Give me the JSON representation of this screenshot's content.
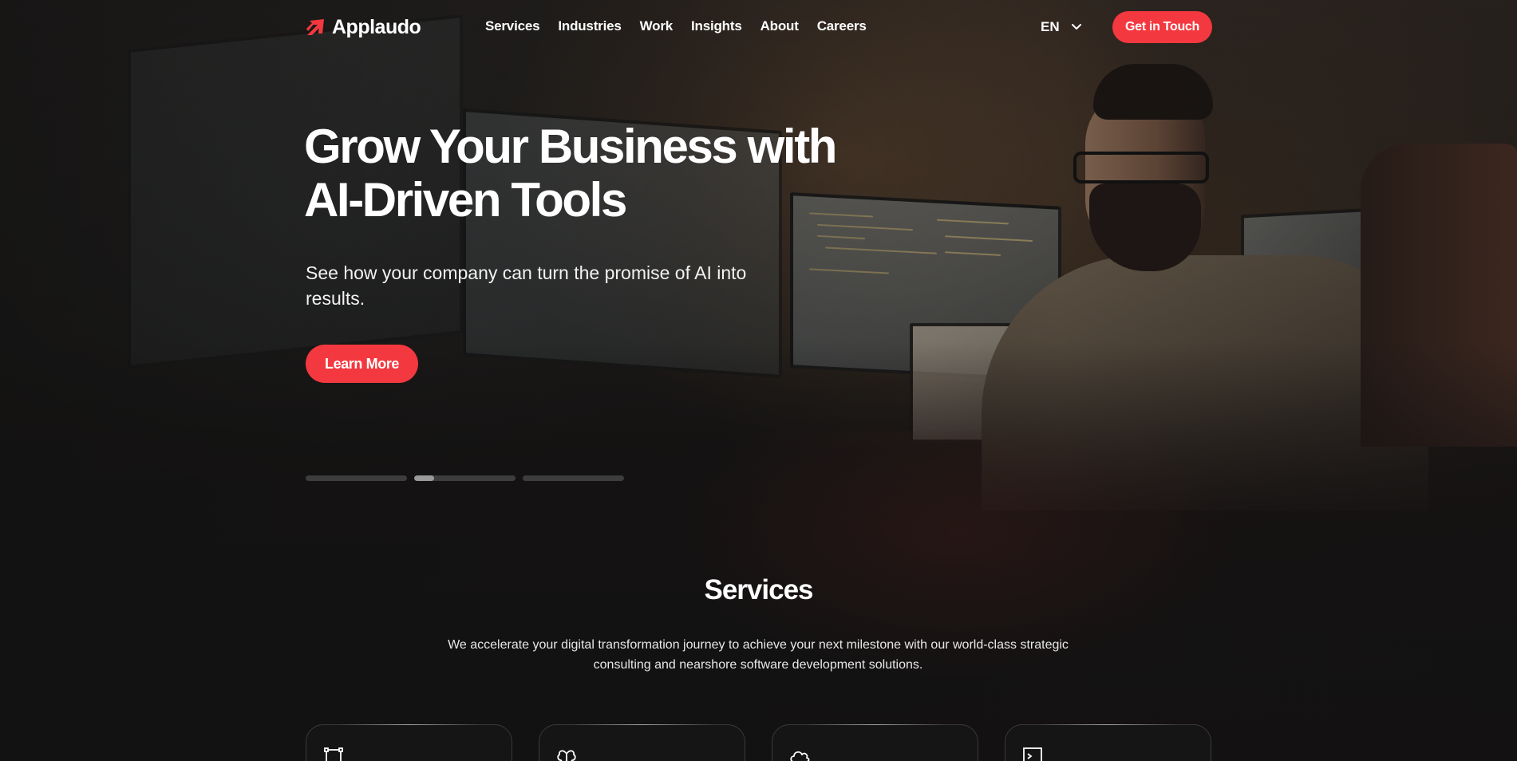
{
  "brand": {
    "name": "Applaudo",
    "accent": "#f4383f"
  },
  "nav": {
    "links": [
      "Services",
      "Industries",
      "Work",
      "Insights",
      "About",
      "Careers"
    ],
    "language": "EN",
    "cta": "Get in Touch"
  },
  "hero": {
    "title_line1": "Grow Your Business with",
    "title_line2": "AI-Driven Tools",
    "subtitle": "See how your company can turn the promise of AI into results.",
    "button": "Learn More",
    "slides": [
      {
        "progress": 0
      },
      {
        "progress": 0.2
      },
      {
        "progress": 0
      }
    ]
  },
  "services": {
    "title": "Services",
    "description": "We accelerate your digital transformation journey to achieve your next milestone with our world-class strategic consulting and nearshore software development solutions.",
    "cards": [
      {
        "icon": "vector-nodes-icon"
      },
      {
        "icon": "brain-icon"
      },
      {
        "icon": "cloud-icon"
      },
      {
        "icon": "terminal-icon"
      }
    ]
  }
}
